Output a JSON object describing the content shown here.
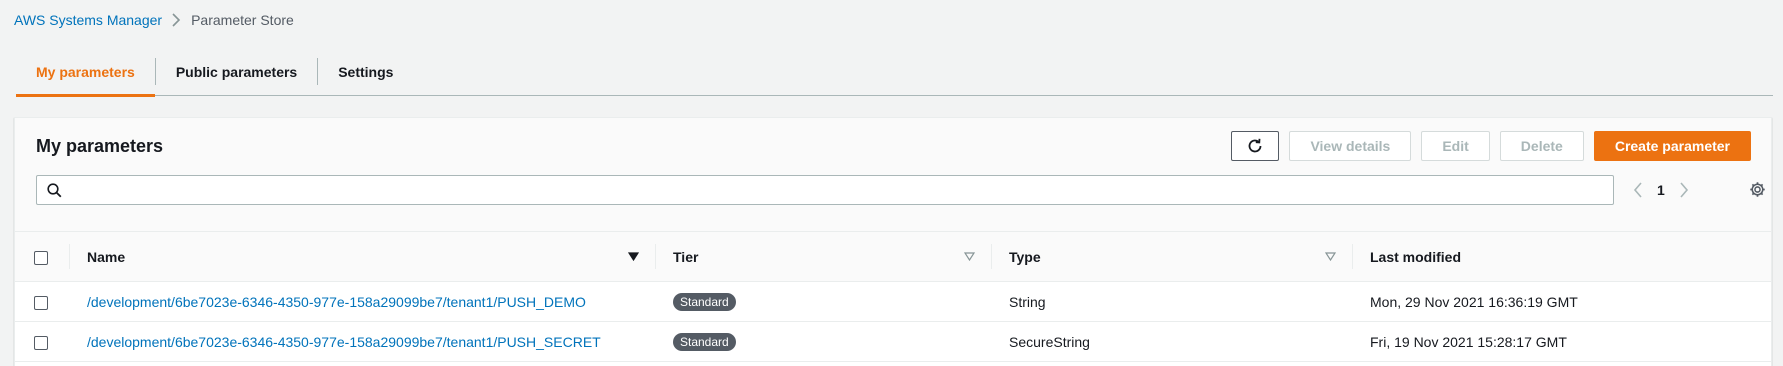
{
  "breadcrumb": {
    "service": "AWS Systems Manager",
    "current": "Parameter Store"
  },
  "tabs": [
    {
      "label": "My parameters",
      "active": true
    },
    {
      "label": "Public parameters",
      "active": false
    },
    {
      "label": "Settings",
      "active": false
    }
  ],
  "panel": {
    "title": "My parameters",
    "buttons": {
      "view_details": "View details",
      "edit": "Edit",
      "delete": "Delete",
      "create": "Create parameter"
    },
    "search": {
      "value": "",
      "placeholder": ""
    },
    "pagination": {
      "page": "1"
    }
  },
  "table": {
    "columns": [
      "Name",
      "Tier",
      "Type",
      "Last modified"
    ],
    "rows": [
      {
        "name": "/development/6be7023e-6346-4350-977e-158a29099be7/tenant1/PUSH_DEMO",
        "tier": "Standard",
        "type": "String",
        "last_modified": "Mon, 29 Nov 2021 16:36:19 GMT"
      },
      {
        "name": "/development/6be7023e-6346-4350-977e-158a29099be7/tenant1/PUSH_SECRET",
        "tier": "Standard",
        "type": "SecureString",
        "last_modified": "Fri, 19 Nov 2021 15:28:17 GMT"
      }
    ]
  },
  "colors": {
    "accent": "#ec7211",
    "link": "#0073bb",
    "badge": "#545b64"
  },
  "icons": {
    "breadcrumb_separator": "chevron-right-icon",
    "refresh": "refresh-icon",
    "search": "search-icon",
    "prev_page": "chevron-left-icon",
    "next_page": "chevron-right-icon",
    "settings": "gear-icon",
    "sort_active": "caret-down-filled-icon",
    "sort_inactive": "caret-down-outline-icon"
  }
}
